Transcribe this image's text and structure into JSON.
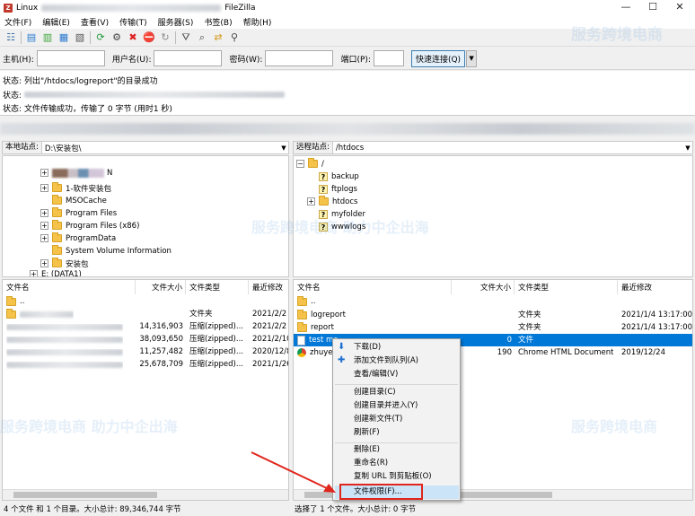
{
  "window": {
    "app_name_prefix": "Linux",
    "app_name": "FileZilla",
    "minimize": "—",
    "maximize": "☐",
    "close": "✕"
  },
  "menu": [
    "文件(F)",
    "编辑(E)",
    "查看(V)",
    "传输(T)",
    "服务器(S)",
    "书签(B)",
    "帮助(H)"
  ],
  "quickconnect": {
    "host_label": "主机(H):",
    "user_label": "用户名(U):",
    "pass_label": "密码(W):",
    "port_label": "端口(P):",
    "connect_button": "快速连接(Q)",
    "dropdown": "▼"
  },
  "log": [
    {
      "key": "状态:",
      "text": "列出\"/htdocs/logreport\"的目录成功"
    },
    {
      "key": "状态:",
      "text": ""
    },
    {
      "key": "状态:",
      "text": "文件传输成功，传输了 0 字节 (用时1 秒)"
    }
  ],
  "local": {
    "site_label": "本地站点:",
    "site_path": "D:\\安装包\\",
    "tree": [
      {
        "label": "N",
        "blurred": true
      },
      {
        "label": "1-软件安装包"
      },
      {
        "label": "MSOCache"
      },
      {
        "label": "Program Files"
      },
      {
        "label": "Program Files (x86)"
      },
      {
        "label": "ProgramData"
      },
      {
        "label": "System Volume Information"
      },
      {
        "label": "安装包"
      },
      {
        "label": "E: (DATA1)"
      }
    ],
    "columns": [
      "文件名",
      "文件大小",
      "文件类型",
      "最近修改"
    ],
    "files": [
      {
        "name": "..",
        "size": "",
        "type": "",
        "date": ""
      },
      {
        "name": "",
        "size": "",
        "type": "文件夹",
        "date": "2021/2/2 1"
      },
      {
        "name": "",
        "size": "14,316,903",
        "type": "压缩(zipped)...",
        "date": "2021/2/2 1"
      },
      {
        "name": "",
        "size": "38,093,650",
        "type": "压缩(zipped)...",
        "date": "2021/2/10"
      },
      {
        "name": "",
        "size": "11,257,482",
        "type": "压缩(zipped)...",
        "date": "2020/12/8"
      },
      {
        "name": "",
        "size": "25,678,709",
        "type": "压缩(zipped)...",
        "date": "2021/1/26"
      }
    ],
    "status": "4 个文件 和 1 个目录。大小总计: 89,346,744 字节"
  },
  "remote": {
    "site_label": "远程站点:",
    "site_path": "/htdocs",
    "tree": [
      {
        "label": "/"
      },
      {
        "label": "backup"
      },
      {
        "label": "ftplogs"
      },
      {
        "label": "htdocs"
      },
      {
        "label": "myfolder"
      },
      {
        "label": "wwwlogs"
      }
    ],
    "columns": [
      "文件名",
      "文件大小",
      "文件类型",
      "最近修改"
    ],
    "files": [
      {
        "name": "..",
        "size": "",
        "type": "",
        "date": ""
      },
      {
        "name": "logreport",
        "size": "",
        "type": "文件夹",
        "date": "2021/1/4 13:17:00"
      },
      {
        "name": "report",
        "size": "",
        "type": "文件夹",
        "date": "2021/1/4 13:17:00"
      },
      {
        "name": "test mo",
        "size": "0",
        "type": "文件",
        "date": ""
      },
      {
        "name": "zhuye.h",
        "size": "190",
        "type": "Chrome HTML Document",
        "date": "2019/12/24"
      }
    ],
    "status": "选择了 1 个文件。大小总计: 0 字节"
  },
  "context_menu": {
    "items": [
      "下载(D)",
      "添加文件到队列(A)",
      "查看/编辑(V)",
      "创建目录(C)",
      "创建目录并进入(Y)",
      "创建新文件(T)",
      "刷新(F)",
      "删除(E)",
      "重命名(R)",
      "复制 URL 到剪贴板(O)",
      "文件权限(F)..."
    ]
  },
  "watermark": {
    "title": "服务跨境电商",
    "subtitle": "服务跨境电商 助力中企出海"
  },
  "colors": {
    "selection": "#0078d7",
    "highlight_box": "#e0261c",
    "arrow": "#e0261c"
  }
}
